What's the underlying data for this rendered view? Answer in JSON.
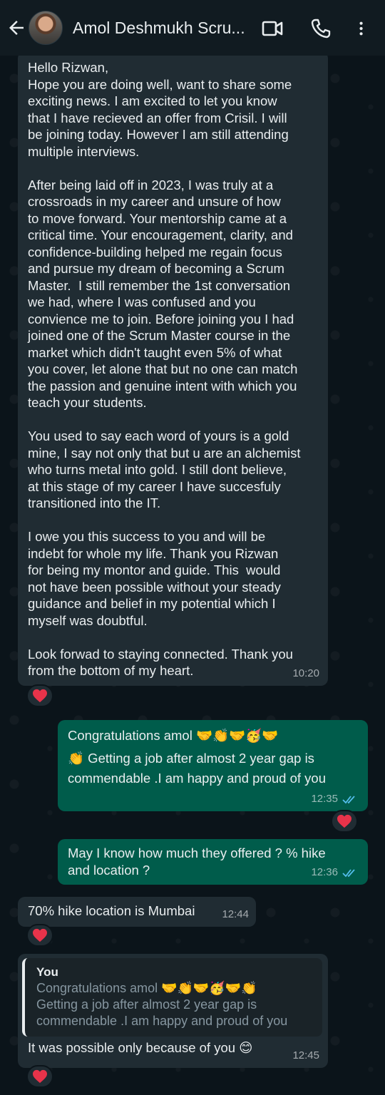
{
  "header": {
    "contact_name": "Amol Deshmukh Scru..."
  },
  "messages": [
    {
      "text": "Hello Rizwan,\nHope you are doing well, want to share some\nexciting news. I am excited to let you know\nthat I have recieved an offer from Crisil. I will\nbe joining today. However I am still attending\nmultiple interviews.\n\nAfter being laid off in 2023, I was truly at a\ncrossroads in my career and unsure of how\nto move forward. Your mentorship came at a\ncritical time. Your encouragement, clarity, and\nconfidence-building helped me regain focus\nand pursue my dream of becoming a Scrum\nMaster.  I still remember the 1st conversation\nwe had, where I was confused and you\nconvience me to join. Before joining you I had\njoined one of the Scrum Master course in the\nmarket which didn't taught even 5% of what\nyou cover, let alone that but no one can match\nthe passion and genuine intent with which you\nteach your students.\n\nYou used to say each word of yours is a gold\nmine, I say not only that but u are an alchemist\nwho turns metal into gold. I still dont believe,\nat this stage of my career I have succesfuly\ntransitioned into the IT.\n\nI owe you this success to you and will be\nindebt for whole my life. Thank you Rizwan\nfor being my montor and guide. This  would\nnot have been possible without your steady\nguidance and belief in my potential which I\nmyself was doubtful.\n\nLook forwad to staying connected. Thank you\nfrom the bottom of my heart.",
      "time": "10:20",
      "reaction": "❤️"
    },
    {
      "line1": "Congratulations amol 🤝👏🤝🥳🤝",
      "line2": "👏 Getting a job after almost 2 year gap is",
      "line3": "commendable .I am happy and proud of you",
      "time": "12:35",
      "reaction": "❤️"
    },
    {
      "text": "May I know how much they offered ? % hike\nand location ?",
      "time": "12:36"
    },
    {
      "text": "70% hike location is Mumbai",
      "time": "12:44",
      "reaction": "❤️"
    },
    {
      "quote_author": "You",
      "quote_text": "Congratulations amol 🤝👏🤝🥳🤝👏\nGetting a job after almost 2 year gap is\ncommendable .I am happy and proud of you",
      "text": "It was possible only because of you 😊",
      "time": "12:45",
      "reaction": "❤️"
    }
  ],
  "colors": {
    "header_bg": "#111b21",
    "incoming_bubble": "#202c33",
    "outgoing_bubble": "#005c4b",
    "read_ticks": "#53bdeb",
    "heart": "#e8334a"
  }
}
